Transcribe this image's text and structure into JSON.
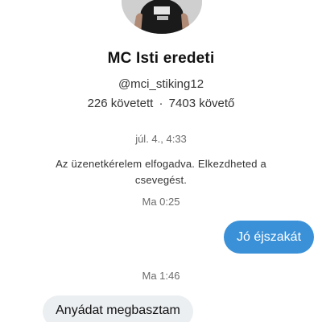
{
  "profile": {
    "name": "MC Isti eredeti",
    "handle": "@mci_stiking12",
    "following": "226 követett",
    "separator": "·",
    "followers": "7403 követő"
  },
  "conversation": {
    "first_timestamp": "júl. 4., 4:33",
    "system_message": "Az üzenetkérelem elfogadva. Elkezdheted a csevegést.",
    "second_timestamp": "Ma 0:25",
    "outgoing_message": "Jó éjszakát",
    "third_timestamp": "Ma 1:46",
    "incoming_message": "Anyádat megbasztam"
  },
  "colors": {
    "outgoing_bubble": "#3a91d8",
    "incoming_bubble": "#eceff2",
    "timestamp_text": "#6b6b6b"
  }
}
